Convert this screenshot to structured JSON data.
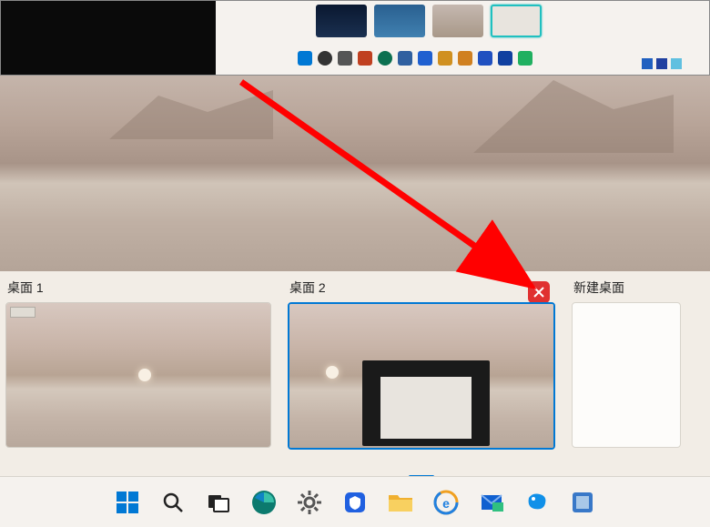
{
  "desktops": [
    {
      "label": "桌面 1"
    },
    {
      "label": "桌面 2"
    }
  ],
  "newDesktop": {
    "label": "新建桌面"
  },
  "taskbar": {
    "icons": [
      {
        "name": "start-icon"
      },
      {
        "name": "search-icon"
      },
      {
        "name": "task-view-icon"
      },
      {
        "name": "edge-icon"
      },
      {
        "name": "settings-icon"
      },
      {
        "name": "security-icon"
      },
      {
        "name": "file-explorer-icon"
      },
      {
        "name": "ie-icon"
      },
      {
        "name": "mail-icon"
      },
      {
        "name": "chat-icon"
      },
      {
        "name": "store-icon"
      }
    ]
  },
  "annotation": {
    "arrowColor": "#ff0000",
    "closeButtonColor": "#e03030"
  }
}
